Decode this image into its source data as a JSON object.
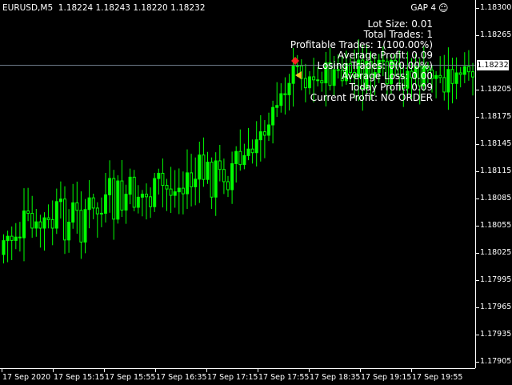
{
  "header": {
    "symbol_info": "EURUSD,M5  1.18224 1.18243 1.18220 1.18232"
  },
  "gap_label": "GAP 4",
  "icons": {
    "status": "smiley-icon",
    "buy_marker": "buy-arrow-icon",
    "sl_marker": "stop-loss-icon"
  },
  "info_panel": [
    "Lot Size: 0.01",
    "Total Trades: 1",
    "Profitable Trades: 1(100.00%)",
    "Average Profit: 0.09",
    "Losing Trades: 0(0.00%)",
    "Average Loss: 0.00",
    "Today Profit: 0.09",
    "Current Profit: NO ORDER"
  ],
  "price_axis": {
    "labels": [
      "1.18300",
      "1.18265",
      "1.18232",
      "1.18205",
      "1.18175",
      "1.18145",
      "1.18115",
      "1.18085",
      "1.18055",
      "1.18025",
      "1.17995",
      "1.17965",
      "1.17935",
      "1.17905"
    ],
    "current_price": "1.18232"
  },
  "time_axis": {
    "labels": [
      "17 Sep 2020",
      "17 Sep 15:15",
      "17 Sep 15:55",
      "17 Sep 16:35",
      "17 Sep 17:15",
      "17 Sep 17:55",
      "17 Sep 18:35",
      "17 Sep 19:15",
      "17 Sep 19:55"
    ]
  },
  "colors": {
    "background": "#000000",
    "candle": "#00ff00",
    "text": "#ffffff",
    "price_line": "#6f7b8a"
  }
}
